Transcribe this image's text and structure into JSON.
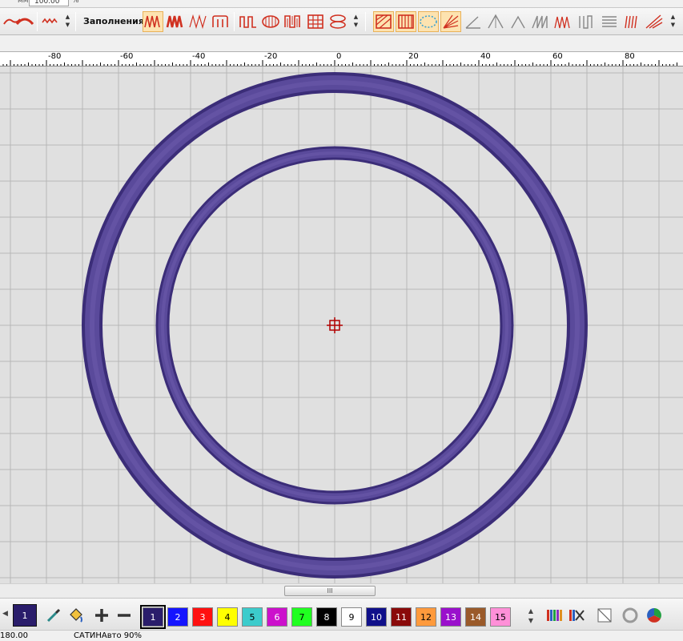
{
  "top_strip": {
    "unit": "мм",
    "value": "100.00",
    "percent": "%"
  },
  "toolbar": {
    "fill_label": "Заполнения:",
    "icons": [
      "embroidery-line-icon",
      "satin-curve-icon",
      "zigzag-line-icon",
      "fill-zigzag-dense-icon",
      "fill-zigzag-bold-icon",
      "fill-zigzag-thin-icon",
      "fill-arch-icon",
      "square-wave-icon",
      "oval-fill-icon",
      "meander-fill-icon",
      "grid-fill-icon",
      "loop-fill-icon",
      "hatch-fill-icon",
      "stripe-fill-icon",
      "dotted-circle-icon",
      "fan-fill-icon",
      "angle-icon",
      "peak-icon",
      "peak-small-icon",
      "sawtooth-icon",
      "comb-icon",
      "lines-icon",
      "radial-icon"
    ]
  },
  "ruler": {
    "labels": [
      "-80",
      "-60",
      "-40",
      "-20",
      "0",
      "20",
      "40",
      "60",
      "80"
    ]
  },
  "canvas": {
    "thread_color": "#4e3f8e",
    "center_mark_color": "#b00000",
    "grid_color": "#b7b7b7",
    "background_color": "#e0e0e0"
  },
  "scrollbar": {
    "thumb_label": "III"
  },
  "palette": {
    "current": {
      "label": "1",
      "color": "#2a1d6b"
    },
    "tools": [
      "eyedropper-icon",
      "paint-bucket-icon",
      "add-color-icon",
      "remove-color-icon"
    ],
    "swatches": [
      {
        "label": "1",
        "color": "#2a1d6b",
        "text": "#ffffff",
        "selected": true
      },
      {
        "label": "2",
        "color": "#1414ff",
        "text": "#ffffff"
      },
      {
        "label": "3",
        "color": "#ff1010",
        "text": "#ffffff"
      },
      {
        "label": "4",
        "color": "#ffff00",
        "text": "#000000"
      },
      {
        "label": "5",
        "color": "#3ccccc",
        "text": "#000000"
      },
      {
        "label": "6",
        "color": "#cc10cc",
        "text": "#ffffff"
      },
      {
        "label": "7",
        "color": "#20ff20",
        "text": "#000000"
      },
      {
        "label": "8",
        "color": "#000000",
        "text": "#ffffff"
      },
      {
        "label": "9",
        "color": "#ffffff",
        "text": "#000000"
      },
      {
        "label": "10",
        "color": "#10108a",
        "text": "#ffffff"
      },
      {
        "label": "11",
        "color": "#8a0a0a",
        "text": "#ffffff"
      },
      {
        "label": "12",
        "color": "#ff9a3c",
        "text": "#000000"
      },
      {
        "label": "13",
        "color": "#9a10cc",
        "text": "#ffffff"
      },
      {
        "label": "14",
        "color": "#9a5a2a",
        "text": "#ffffff"
      },
      {
        "label": "15",
        "color": "#ff90d8",
        "text": "#000000"
      }
    ],
    "right_tools": [
      "thread-chart-icon",
      "thread-chart-x-icon",
      "no-color-icon",
      "circle-outline-icon",
      "color-wheel-icon"
    ]
  },
  "status": {
    "value": "180.00",
    "text": "САТИНАвто 90%"
  }
}
